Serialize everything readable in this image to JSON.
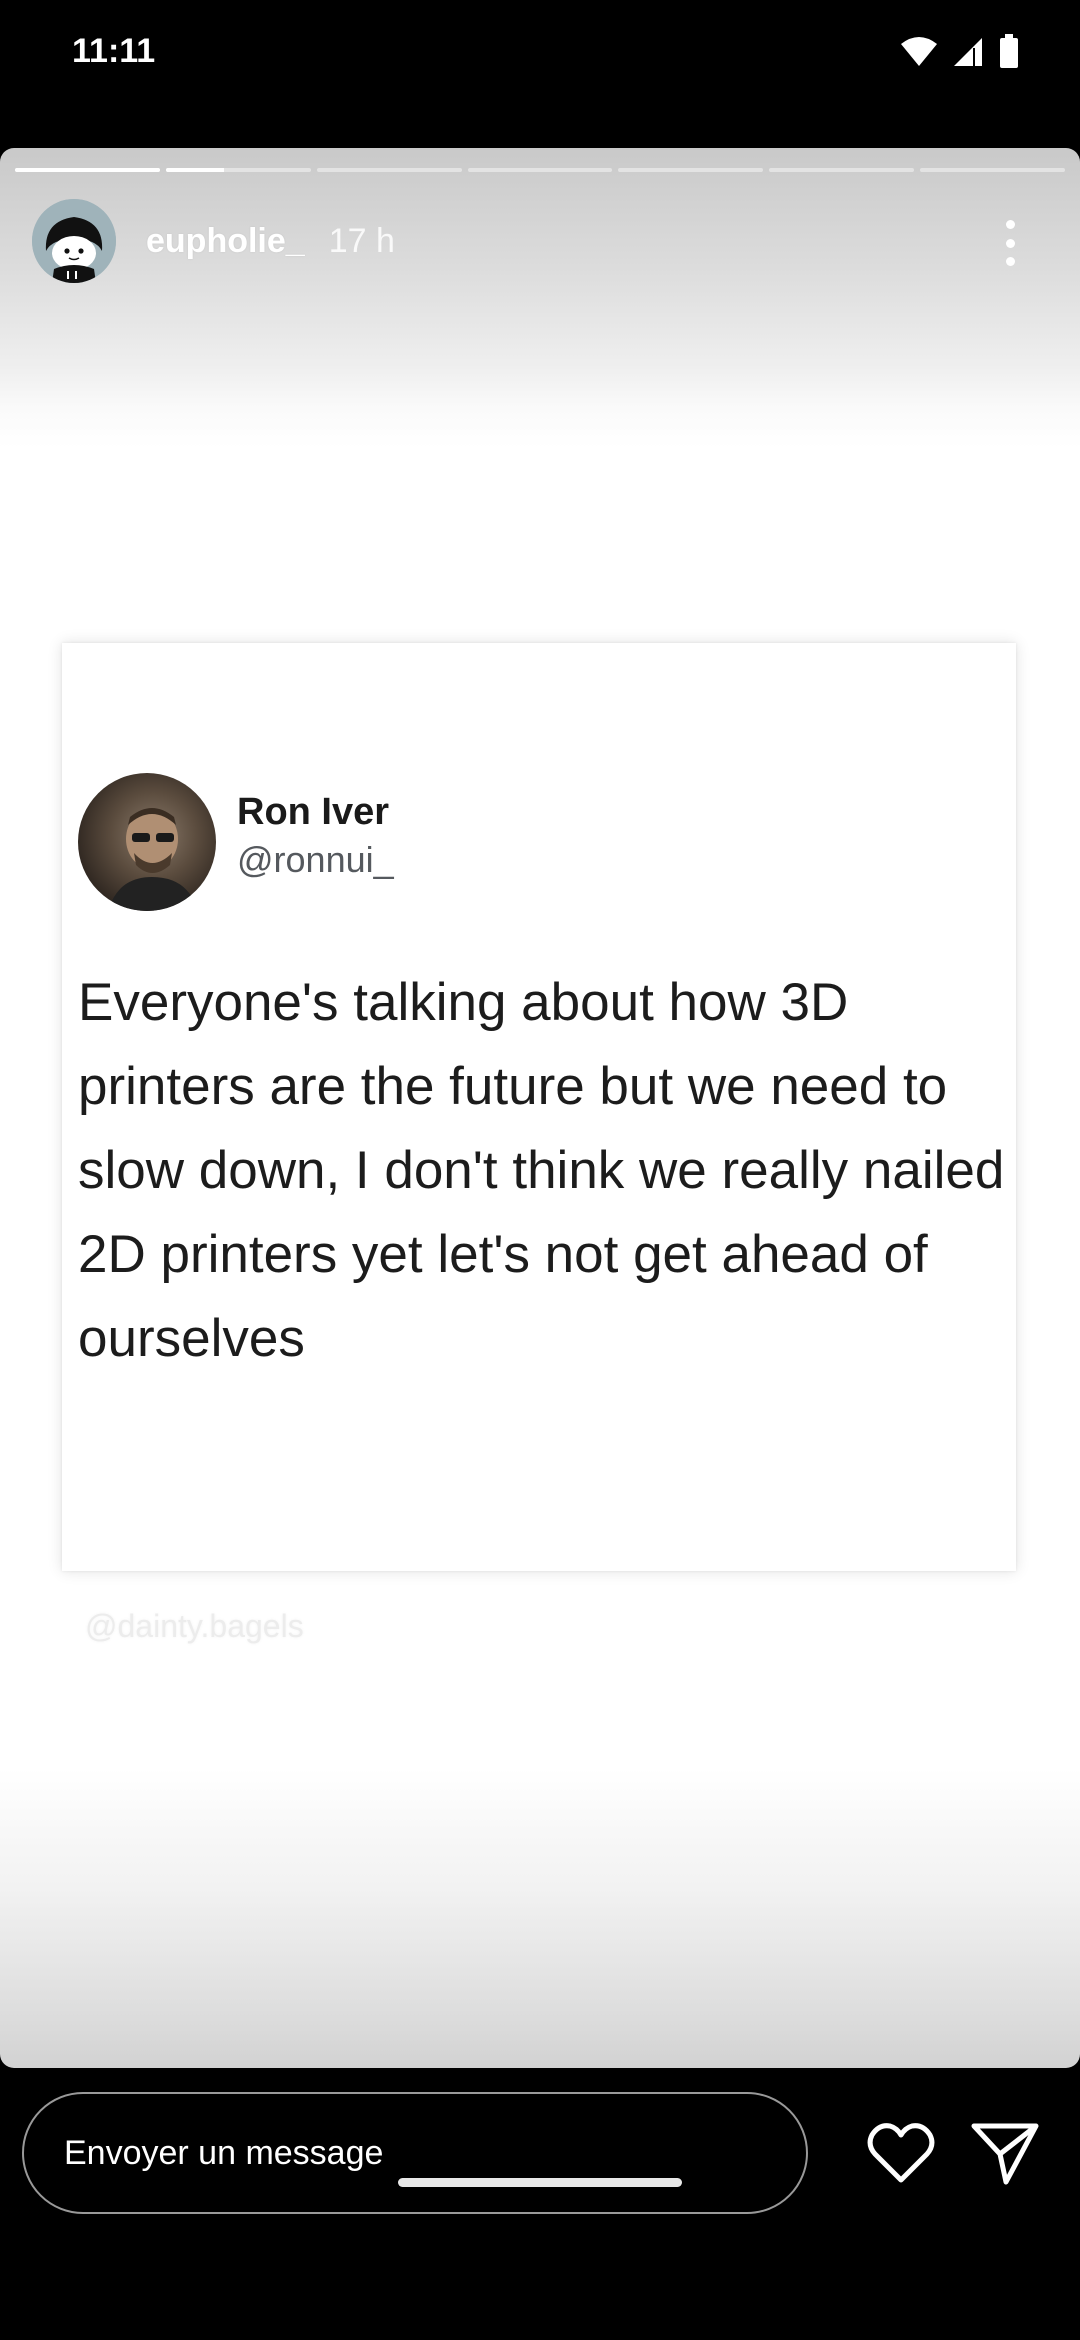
{
  "status_bar": {
    "time": "11:11",
    "icons": [
      "wifi-icon",
      "signal-icon",
      "battery-icon"
    ]
  },
  "story": {
    "progress": {
      "segments": 7,
      "active_index": 1,
      "active_fraction": 0.4
    },
    "header": {
      "username": "eupholie_",
      "time_ago": "17 h",
      "menu_icon": "more-vertical-icon"
    },
    "tweet": {
      "name": "Ron Iver",
      "handle": "@ronnui_",
      "text": "Everyone's talking about how 3D printers are the future but we need to slow down, I don't think we really nailed 2D printers yet let's not get ahead of ourselves"
    },
    "watermark": "@dainty.bagels"
  },
  "reply_bar": {
    "placeholder": "Envoyer un message",
    "like_icon": "heart-icon",
    "send_icon": "send-icon"
  },
  "colors": {
    "background": "#000000",
    "card": "#ffffff",
    "tweet_text": "#1c1c1c",
    "handle": "#55595e"
  }
}
